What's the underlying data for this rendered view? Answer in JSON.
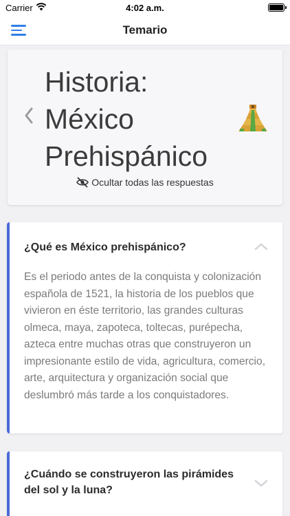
{
  "status_bar": {
    "carrier": "Carrier",
    "time": "4:02 a.m."
  },
  "nav": {
    "title": "Temario"
  },
  "topic": {
    "title": "Historia: México Prehispánico",
    "hide_answers_label": "Ocultar todas las respuestas"
  },
  "questions": [
    {
      "question": "¿Qué es México prehispánico?",
      "answer": "Es el periodo antes de la conquista y colonización española de 1521, la historia de los pueblos que vivieron en éste territorio, las grandes culturas olmeca, maya, zapoteca, toltecas, purépecha, azteca entre muchas otras que construyeron un impresionante estilo de vida, agricultura, comercio, arte, arquitectura y organización social que deslumbró más tarde a los conquistadores.",
      "expanded": true
    },
    {
      "question": "¿Cuándo se construyeron las pirámides del sol y la luna?",
      "expanded": false
    }
  ],
  "colors": {
    "accent": "#2f7fe6",
    "card_border": "#4a6bd8"
  },
  "icons": {
    "menu": "hamburger-menu-icon",
    "back": "chevron-left-icon",
    "topic": "pyramid-icon",
    "hide": "eye-slash-icon",
    "collapse": "chevron-up-icon",
    "expand": "chevron-down-icon"
  }
}
